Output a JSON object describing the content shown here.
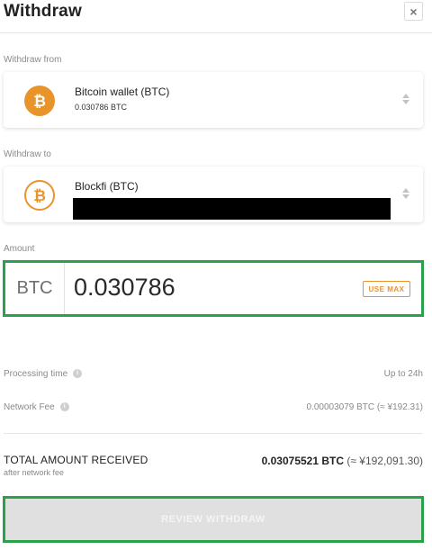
{
  "header": {
    "title": "Withdraw",
    "close_label": "×"
  },
  "withdraw_from": {
    "label": "Withdraw from",
    "wallet_name": "Bitcoin wallet (BTC)",
    "balance": "0.030786 BTC",
    "icon": "bitcoin-icon"
  },
  "withdraw_to": {
    "label": "Withdraw to",
    "wallet_name": "Blockfi (BTC)",
    "icon": "bitcoin-icon"
  },
  "amount": {
    "label": "Amount",
    "unit": "BTC",
    "value": "0.030786",
    "use_max_label": "USE MAX"
  },
  "processing": {
    "label": "Processing time",
    "value": "Up to 24h"
  },
  "network_fee": {
    "label": "Network Fee",
    "value": "0.00003079 BTC (≈ ¥192.31)"
  },
  "total": {
    "label": "TOTAL AMOUNT RECEIVED",
    "sublabel": "after network fee",
    "value_btc": "0.03075521 BTC",
    "value_fiat": " (≈ ¥192,091.30)"
  },
  "review_button_label": "REVIEW WITHDRAW",
  "colors": {
    "accent": "#e9932b",
    "highlight": "#2aa14a"
  }
}
